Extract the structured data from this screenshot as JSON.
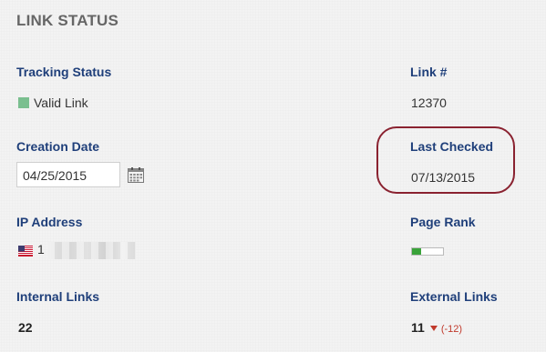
{
  "header": {
    "title": "LINK STATUS"
  },
  "tracking_status": {
    "label": "Tracking Status",
    "value": "Valid Link",
    "color": "#7abf8f"
  },
  "link_number": {
    "label": "Link #",
    "value": "12370"
  },
  "creation_date": {
    "label": "Creation Date",
    "value": "04/25/2015",
    "icon": "calendar-icon"
  },
  "last_checked": {
    "label": "Last Checked",
    "value": "07/13/2015",
    "highlight_color": "#8a2230"
  },
  "ip_address": {
    "label": "IP Address",
    "value_visible": "1",
    "flag": "us-flag-icon"
  },
  "page_rank": {
    "label": "Page Rank",
    "level_fraction": 0.3,
    "color": "#3aa33a"
  },
  "internal_links": {
    "label": "Internal Links",
    "value": "22"
  },
  "external_links": {
    "label": "External Links",
    "value": "11",
    "change": "(-12)",
    "change_icon": "down-arrow-icon"
  }
}
